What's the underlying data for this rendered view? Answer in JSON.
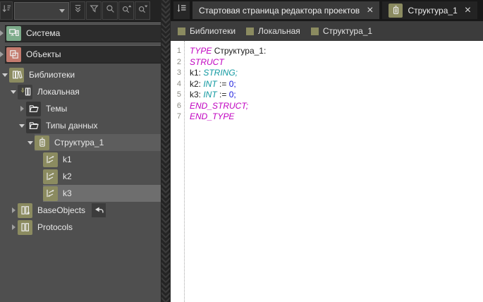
{
  "colors": {
    "olive_accent": "#8b8b60",
    "system_green": "#7cab8a",
    "objects_red": "#c47b6e",
    "dark_icon_bg": "#3a3a3a",
    "selection_soft": "#5d5d5d",
    "selection_strong": "#6e6e6e"
  },
  "toolbar": {
    "combo": {
      "value": "",
      "placeholder": ""
    },
    "buttons": [
      {
        "name": "collapse-all",
        "icon": "collapse-all-icon"
      },
      {
        "name": "filter",
        "icon": "filter-icon"
      },
      {
        "name": "search",
        "icon": "search-icon"
      },
      {
        "name": "search-previous",
        "icon": "search-up-icon"
      },
      {
        "name": "search-next",
        "icon": "search-down-icon"
      }
    ]
  },
  "tabbar": {
    "tabs": [
      {
        "name": "start-page",
        "label": "Стартовая страница редактора проектов",
        "icon": null,
        "close": "×",
        "shade": "light"
      },
      {
        "name": "structure-1",
        "label": "Структура_1",
        "icon": "struct-icon",
        "icon_bg": "#8b8b60",
        "close": "×",
        "shade": "dark"
      }
    ]
  },
  "breadcrumb": {
    "items": [
      {
        "name": "libraries",
        "label": "Библиотеки"
      },
      {
        "name": "local",
        "label": "Локальная"
      },
      {
        "name": "structure-1",
        "label": "Структура_1"
      }
    ]
  },
  "sidebar": {
    "sections": [
      {
        "name": "system",
        "label": "Система",
        "icon": "system-icon",
        "icon_bg": "#7cab8a"
      },
      {
        "name": "objects",
        "label": "Объекты",
        "icon": "objects-icon",
        "icon_bg": "#c47b6e"
      }
    ],
    "tree": [
      {
        "name": "libraries",
        "label": "Библиотеки",
        "icon": "libraries-icon",
        "icon_bg": "#8b8b60",
        "level": 0,
        "expander": "expanded"
      },
      {
        "name": "local",
        "label": "Локальная",
        "icon": "local-icon",
        "icon_bg": "#3f3f3f",
        "level": 1,
        "expander": "expanded"
      },
      {
        "name": "themes",
        "label": "Темы",
        "icon": "folder-icon",
        "icon_bg": "#383838",
        "level": 2,
        "expander": "collapsed"
      },
      {
        "name": "data-types",
        "label": "Типы данных",
        "icon": "folder-icon",
        "icon_bg": "#383838",
        "level": 2,
        "expander": "expanded"
      },
      {
        "name": "structure-1",
        "label": "Структура_1",
        "icon": "struct-icon",
        "icon_bg": "#8b8b60",
        "level": 3,
        "expander": "expanded",
        "selected": "soft"
      },
      {
        "name": "k1",
        "label": "k1",
        "icon": "variable-icon",
        "icon_bg": "#8b8b60",
        "level": 4
      },
      {
        "name": "k2",
        "label": "k2",
        "icon": "variable-icon",
        "icon_bg": "#8b8b60",
        "level": 4
      },
      {
        "name": "k3",
        "label": "k3",
        "icon": "variable-icon",
        "icon_bg": "#8b8b60",
        "level": 4,
        "selected": "strong"
      },
      {
        "name": "baseobjects",
        "label": "BaseObjects",
        "icon": "books-plus-icon",
        "icon_bg": "#8b8b60",
        "level": 1,
        "expander": "collapsed",
        "trailing_icon": "undo-arrow-icon"
      },
      {
        "name": "protocols",
        "label": "Protocols",
        "icon": "books-icon",
        "icon_bg": "#8b8b60",
        "level": 1,
        "expander": "collapsed"
      }
    ]
  },
  "editor": {
    "token_colors": {
      "keyword": "#c000c0",
      "type": "#0f98a0",
      "number": "#1515dd",
      "plain": "#1c1c1c"
    },
    "lines": [
      {
        "num": "1",
        "segments": [
          {
            "text": "TYPE ",
            "style": "keyword"
          },
          {
            "text": "Структура_1:",
            "style": "plain"
          }
        ]
      },
      {
        "num": "2",
        "segments": [
          {
            "text": "STRUCT",
            "style": "keyword"
          }
        ]
      },
      {
        "num": "3",
        "segments": [
          {
            "text": "k1: ",
            "style": "plain"
          },
          {
            "text": "STRING;",
            "style": "type"
          }
        ]
      },
      {
        "num": "4",
        "segments": [
          {
            "text": "k2: ",
            "style": "plain"
          },
          {
            "text": "INT",
            "style": "type"
          },
          {
            "text": " := ",
            "style": "plain"
          },
          {
            "text": "0;",
            "style": "number"
          }
        ]
      },
      {
        "num": "5",
        "segments": [
          {
            "text": "k3: ",
            "style": "plain"
          },
          {
            "text": "INT",
            "style": "type"
          },
          {
            "text": " := ",
            "style": "plain"
          },
          {
            "text": "0;",
            "style": "number"
          }
        ]
      },
      {
        "num": "6",
        "segments": [
          {
            "text": "END_STRUCT;",
            "style": "keyword"
          }
        ]
      },
      {
        "num": "7",
        "segments": [
          {
            "text": "END_TYPE",
            "style": "keyword"
          }
        ]
      }
    ]
  }
}
